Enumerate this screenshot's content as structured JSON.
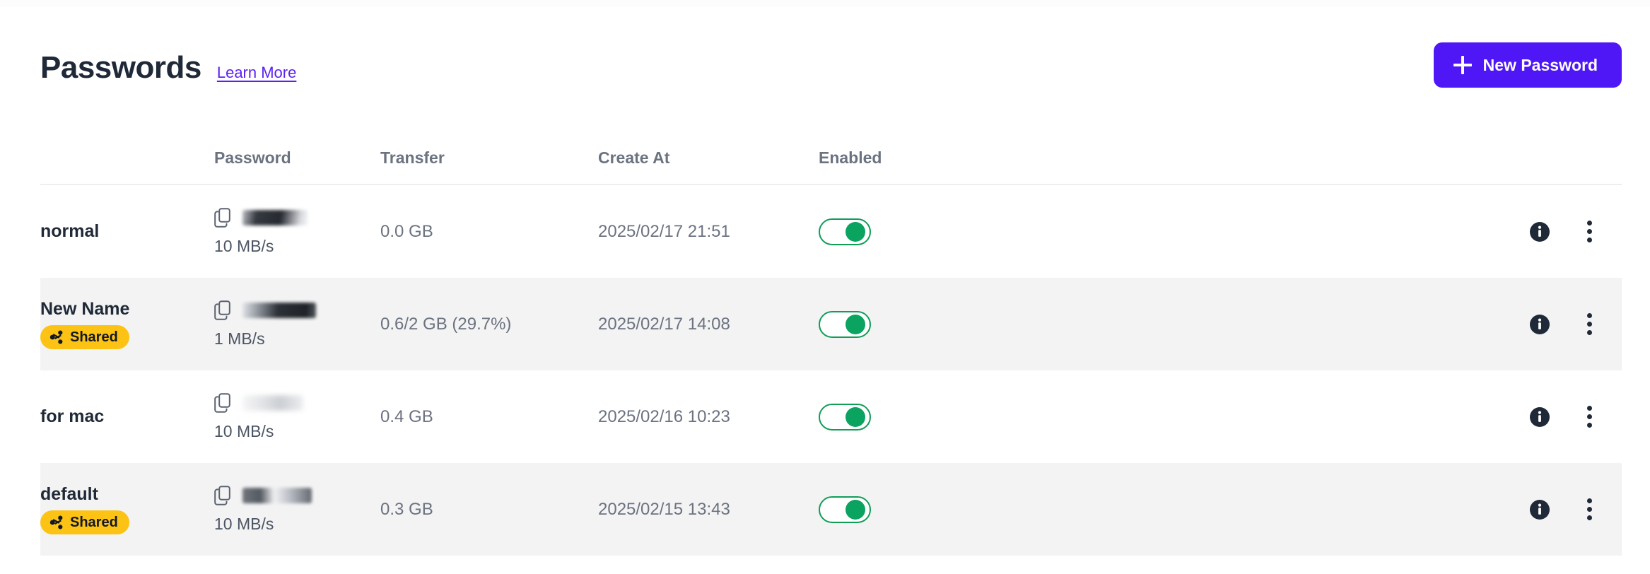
{
  "header": {
    "title": "Passwords",
    "learn_more": "Learn More",
    "new_password_button": "New Password",
    "accent_color": "#4f17f5",
    "link_color": "#5b21f0"
  },
  "table": {
    "columns": {
      "name": "",
      "password": "Password",
      "transfer": "Transfer",
      "created": "Create At",
      "enabled": "Enabled"
    },
    "rows": [
      {
        "name": "normal",
        "shared": false,
        "shared_label": "",
        "password_masked": "••••••••",
        "speed": "10 MB/s",
        "transfer": "0.0 GB",
        "created": "2025/02/17 21:51",
        "enabled": true
      },
      {
        "name": "New Name",
        "shared": true,
        "shared_label": "Shared",
        "password_masked": "••••••••",
        "speed": "1 MB/s",
        "transfer": "0.6/2 GB (29.7%)",
        "created": "2025/02/17 14:08",
        "enabled": true
      },
      {
        "name": "for mac",
        "shared": false,
        "shared_label": "",
        "password_masked": "••••••••",
        "speed": "10 MB/s",
        "transfer": "0.4 GB",
        "created": "2025/02/16 10:23",
        "enabled": true
      },
      {
        "name": "default",
        "shared": true,
        "shared_label": "Shared",
        "password_masked": "••••••••",
        "speed": "10 MB/s",
        "transfer": "0.3 GB",
        "created": "2025/02/15 13:43",
        "enabled": true
      }
    ]
  },
  "icons": {
    "plus": "plus-icon",
    "copy": "copy-icon",
    "share": "share-icon",
    "info": "info-icon",
    "menu": "more-vertical-icon"
  },
  "colors": {
    "toggle_on": "#0ba360",
    "badge_shared": "#fcc314",
    "row_alt_background": "#f3f3f3"
  }
}
